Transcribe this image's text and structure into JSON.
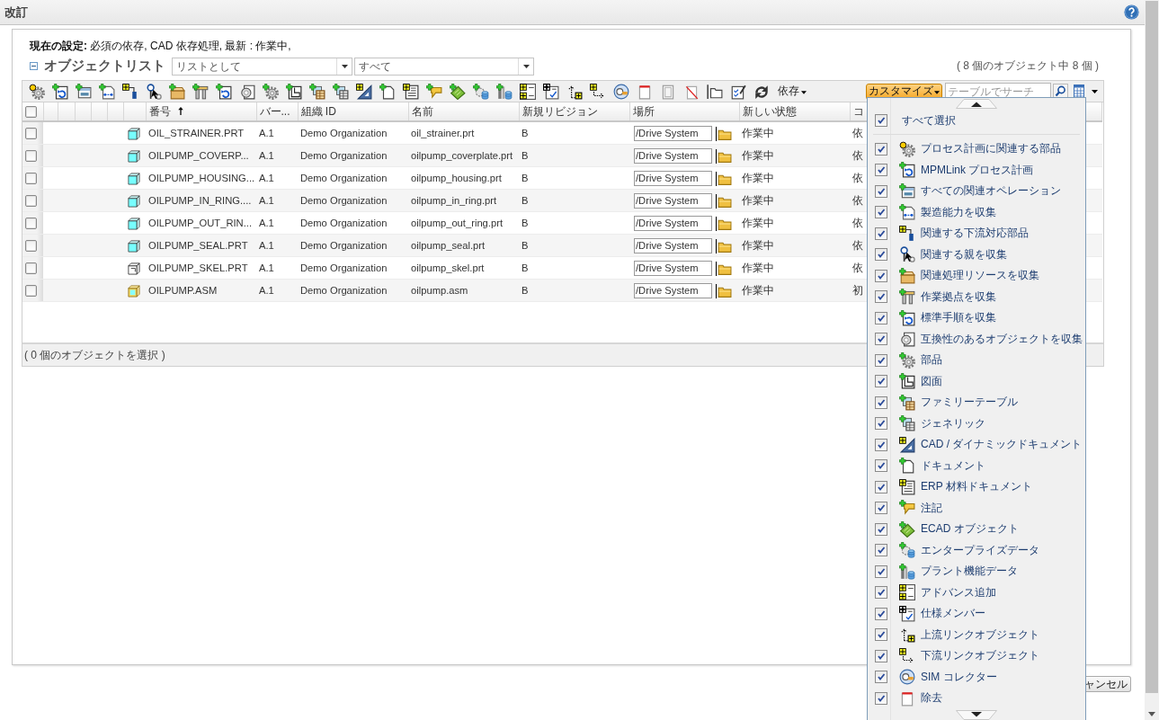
{
  "page": {
    "title": "改訂"
  },
  "settings": {
    "text": "**現在の設定:** 必須の依存, CAD 依存処理, 最新 : 作業中,"
  },
  "object_list": {
    "title": "オブジェクトリスト",
    "expanded": true,
    "view_select": {
      "value": "リストとして"
    },
    "filter_select": {
      "value": "すべて"
    },
    "count": "( 8 個のオブジェクト中 8 個 )"
  },
  "toolbar": {
    "dependency_menu": {
      "label": "依存"
    },
    "customize_button": {
      "label": "カスタマイズ"
    },
    "search": {
      "placeholder": "テーブルでサーチ"
    }
  },
  "table": {
    "select_all": {
      "checked": false
    },
    "columns": [
      {
        "label": "番号",
        "sorted": true
      },
      {
        "label": "バー...",
        "sorted": false
      },
      {
        "label": "組織 ID",
        "sorted": false
      },
      {
        "label": "名前",
        "sorted": false
      },
      {
        "label": "新規リビジョン",
        "sorted": false
      },
      {
        "label": "場所",
        "sorted": false
      },
      {
        "label": "新しい状態",
        "sorted": false
      },
      {
        "label": "コ",
        "sorted": false
      }
    ],
    "rows": [
      {
        "checked": false,
        "kind": "part",
        "number": "OIL_STRAINER.PRT",
        "version": "A.1",
        "organization": "Demo Organization",
        "name": "oil_strainer.prt",
        "revision": "B",
        "location": "/Drive System",
        "state": "作業中",
        "column_8": "依"
      },
      {
        "checked": false,
        "kind": "part",
        "number": "OILPUMP_COVERP...",
        "version": "A.1",
        "organization": "Demo Organization",
        "name": "oilpump_coverplate.prt",
        "revision": "B",
        "location": "/Drive System",
        "state": "作業中",
        "column_8": "依"
      },
      {
        "checked": false,
        "kind": "part",
        "number": "OILPUMP_HOUSING...",
        "version": "A.1",
        "organization": "Demo Organization",
        "name": "oilpump_housing.prt",
        "revision": "B",
        "location": "/Drive System",
        "state": "作業中",
        "column_8": "依"
      },
      {
        "checked": false,
        "kind": "part",
        "number": "OILPUMP_IN_RING....",
        "version": "A.1",
        "organization": "Demo Organization",
        "name": "oilpump_in_ring.prt",
        "revision": "B",
        "location": "/Drive System",
        "state": "作業中",
        "column_8": "依"
      },
      {
        "checked": false,
        "kind": "part",
        "number": "OILPUMP_OUT_RIN...",
        "version": "A.1",
        "organization": "Demo Organization",
        "name": "oilpump_out_ring.prt",
        "revision": "B",
        "location": "/Drive System",
        "state": "作業中",
        "column_8": "依"
      },
      {
        "checked": false,
        "kind": "part",
        "number": "OILPUMP_SEAL.PRT",
        "version": "A.1",
        "organization": "Demo Organization",
        "name": "oilpump_seal.prt",
        "revision": "B",
        "location": "/Drive System",
        "state": "作業中",
        "column_8": "依"
      },
      {
        "checked": false,
        "kind": "skeleton",
        "number": "OILPUMP_SKEL.PRT",
        "version": "A.1",
        "organization": "Demo Organization",
        "name": "oilpump_skel.prt",
        "revision": "B",
        "location": "/Drive System",
        "state": "作業中",
        "column_8": "依"
      },
      {
        "checked": false,
        "kind": "assembly",
        "number": "OILPUMP.ASM",
        "version": "A.1",
        "organization": "Demo Organization",
        "name": "oilpump.asm",
        "revision": "B",
        "location": "/Drive System",
        "state": "作業中",
        "column_8": "初"
      }
    ],
    "footer": "( 0 個のオブジェクトを選択 )"
  },
  "customize_menu": {
    "select_all": {
      "label": "すべて選択",
      "checked": true
    },
    "items": [
      {
        "label": "プロセス計画に関連する部品",
        "checked": true
      },
      {
        "label": "MPMLink プロセス計画",
        "checked": true
      },
      {
        "label": "すべての関連オペレーション",
        "checked": true
      },
      {
        "label": "製造能力を収集",
        "checked": true
      },
      {
        "label": "関連する下流対応部品",
        "checked": true
      },
      {
        "label": "関連する親を収集",
        "checked": true
      },
      {
        "label": "関連処理リソースを収集",
        "checked": true
      },
      {
        "label": "作業拠点を収集",
        "checked": true
      },
      {
        "label": "標準手順を収集",
        "checked": true
      },
      {
        "label": "互換性のあるオブジェクトを収集",
        "checked": true
      },
      {
        "label": "部品",
        "checked": true
      },
      {
        "label": "図面",
        "checked": true
      },
      {
        "label": "ファミリーテーブル",
        "checked": true
      },
      {
        "label": "ジェネリック",
        "checked": true
      },
      {
        "label": "CAD / ダイナミックドキュメント",
        "checked": true
      },
      {
        "label": "ドキュメント",
        "checked": true
      },
      {
        "label": "ERP 材料ドキュメント",
        "checked": true
      },
      {
        "label": "注記",
        "checked": true
      },
      {
        "label": "ECAD オブジェクト",
        "checked": true
      },
      {
        "label": "エンタープライズデータ",
        "checked": true
      },
      {
        "label": "プラント機能データ",
        "checked": true
      },
      {
        "label": "アドバンス追加",
        "checked": true
      },
      {
        "label": "仕様メンバー",
        "checked": true
      },
      {
        "label": "上流リンクオブジェクト",
        "checked": true
      },
      {
        "label": "下流リンクオブジェクト",
        "checked": true
      },
      {
        "label": "SIM コレクター",
        "checked": true
      },
      {
        "label": "除去",
        "checked": true
      }
    ]
  },
  "buttons": [
    {
      "label": "ャンセル"
    }
  ]
}
